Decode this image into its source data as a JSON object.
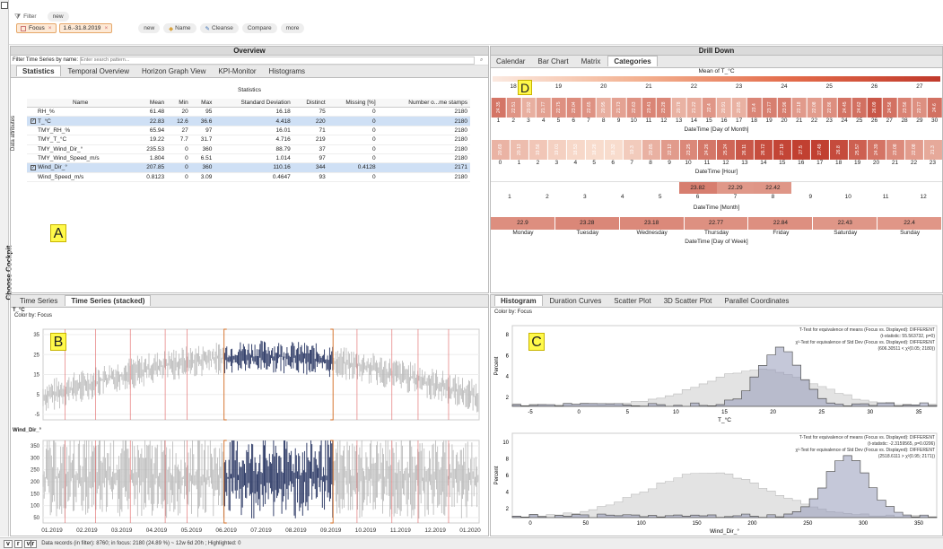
{
  "filter": {
    "label": "Filter",
    "new_pill": "new",
    "chip_focus": "Focus",
    "chip_dates": "1.6.-31.8.2019",
    "actions": [
      "new",
      "Name",
      "Cleanse",
      "Compare",
      "more"
    ]
  },
  "overview": {
    "title": "Overview",
    "search_label": "Filter Time Series by name:",
    "search_placeholder": "Enter search pattern...",
    "tabs": [
      "Statistics",
      "Temporal Overview",
      "Horizon Graph View",
      "KPI-Monitor",
      "Histograms"
    ],
    "table_title": "Statistics",
    "side_label": "Data attributes",
    "columns": [
      "Name",
      "Mean",
      "Min",
      "Max",
      "Standard Deviation",
      "Distinct",
      "Missing [%]",
      "Number o...me stamps"
    ],
    "rows": [
      {
        "name": "RH_%",
        "mean": "61.48",
        "min": "20",
        "max": "95",
        "sd": "16.18",
        "distinct": "75",
        "missing": "0",
        "n": "2180",
        "checked": false,
        "hl": false
      },
      {
        "name": "T_°C",
        "mean": "22.83",
        "min": "12.6",
        "max": "36.6",
        "sd": "4.418",
        "distinct": "220",
        "missing": "0",
        "n": "2180",
        "checked": true,
        "hl": true
      },
      {
        "name": "TMY_RH_%",
        "mean": "65.94",
        "min": "27",
        "max": "97",
        "sd": "16.01",
        "distinct": "71",
        "missing": "0",
        "n": "2180",
        "checked": false,
        "hl": false
      },
      {
        "name": "TMY_T_°C",
        "mean": "19.22",
        "min": "7.7",
        "max": "31.7",
        "sd": "4.716",
        "distinct": "219",
        "missing": "0",
        "n": "2180",
        "checked": false,
        "hl": false
      },
      {
        "name": "TMY_Wind_Dir_°",
        "mean": "235.53",
        "min": "0",
        "max": "360",
        "sd": "88.79",
        "distinct": "37",
        "missing": "0",
        "n": "2180",
        "checked": false,
        "hl": false
      },
      {
        "name": "TMY_Wind_Speed_m/s",
        "mean": "1.804",
        "min": "0",
        "max": "6.51",
        "sd": "1.014",
        "distinct": "97",
        "missing": "0",
        "n": "2180",
        "checked": false,
        "hl": false
      },
      {
        "name": "Wind_Dir_°",
        "mean": "207.85",
        "min": "0",
        "max": "360",
        "sd": "110.16",
        "distinct": "344",
        "missing": "0.4128",
        "n": "2171",
        "checked": true,
        "hl": true
      },
      {
        "name": "Wind_Speed_m/s",
        "mean": "0.8123",
        "min": "0",
        "max": "3.09",
        "sd": "0.4647",
        "distinct": "93",
        "missing": "0",
        "n": "2180",
        "checked": false,
        "hl": false
      }
    ]
  },
  "markers": {
    "a": "A",
    "b": "B",
    "c": "C",
    "d": "D"
  },
  "cockpit_label": "Choose Cockpit",
  "drill": {
    "title": "Drill Down",
    "tabs": [
      "Calendar",
      "Bar Chart",
      "Matrix",
      "Categories"
    ],
    "mean_label": "Mean of T_°C",
    "scale": [
      "18",
      "19",
      "20",
      "21",
      "22",
      "23",
      "24",
      "25",
      "26",
      "27"
    ],
    "day_values": [
      "24.35",
      "22.51",
      "20.92",
      "21.77",
      "22.75",
      "23.04",
      "22.65",
      "20.95",
      "21.73",
      "22.63",
      "23.41",
      "23.28",
      "20.78",
      "21.22",
      "22.4",
      "20.91",
      "20.85",
      "23.4",
      "23.77",
      "23.96",
      "22.18",
      "22.08",
      "22.86",
      "24.45",
      "24.62",
      "26.09",
      "24.56",
      "23.56",
      "22.77",
      "24.6"
    ],
    "day_labels": [
      "1",
      "2",
      "3",
      "4",
      "5",
      "6",
      "7",
      "8",
      "9",
      "10",
      "11",
      "12",
      "13",
      "14",
      "15",
      "16",
      "17",
      "18",
      "19",
      "20",
      "21",
      "22",
      "23",
      "24",
      "25",
      "26",
      "27",
      "28",
      "29",
      "30"
    ],
    "day_axis": "DateTime [Day of Month]",
    "hour_values": [
      "20.69",
      "20.13",
      "19.56",
      "19.01",
      "18.53",
      "18.28",
      "18.32",
      "19.3",
      "20.85",
      "22.12",
      "23.25",
      "24.26",
      "25.24",
      "26.11",
      "26.72",
      "27.19",
      "27.5",
      "27.49",
      "26.8",
      "25.57",
      "24.39",
      "23.08",
      "22.08",
      "21.3"
    ],
    "hour_labels": [
      "0",
      "1",
      "2",
      "3",
      "4",
      "5",
      "6",
      "7",
      "8",
      "9",
      "10",
      "11",
      "12",
      "13",
      "14",
      "15",
      "16",
      "17",
      "18",
      "19",
      "20",
      "21",
      "22",
      "23"
    ],
    "hour_axis": "DateTime [Hour]",
    "month_labels": [
      "1",
      "2",
      "3",
      "4",
      "5",
      "6",
      "7",
      "8",
      "9",
      "10",
      "11",
      "12"
    ],
    "month_values": {
      "6": "23.82",
      "7": "22.29",
      "8": "22.42"
    },
    "month_axis": "DateTime [Month]",
    "weekday_values": [
      "22.9",
      "23.28",
      "23.18",
      "22.77",
      "22.84",
      "22.43",
      "22.4"
    ],
    "weekday_labels": [
      "Monday",
      "Tuesday",
      "Wednesday",
      "Thursday",
      "Friday",
      "Saturday",
      "Sunday"
    ],
    "weekday_axis": "DateTime [Day of Week]"
  },
  "timeseries": {
    "tabs": [
      "Time Series",
      "Time Series (stacked)"
    ],
    "series1": "T_°C",
    "color_by": "Color by: Focus",
    "y1": [
      "35",
      "25",
      "15",
      "5",
      "-5"
    ],
    "series2": "Wind_Dir_°",
    "y2": [
      "350",
      "300",
      "250",
      "200",
      "150",
      "100",
      "50"
    ],
    "months": [
      "01.2019",
      "02.2019",
      "03.2019",
      "04.2019",
      "05.2019",
      "06.2019",
      "07.2019",
      "08.2019",
      "09.2019",
      "10.2019",
      "11.2019",
      "12.2019",
      "01.2020"
    ]
  },
  "histogram": {
    "tabs": [
      "Histogram",
      "Duration Curves",
      "Scatter Plot",
      "3D Scatter Plot",
      "Parallel Coordinates"
    ],
    "color_by": "Color by: Focus",
    "ylabel": "Percent",
    "h1_text": [
      "T-Test for equivalence of means (Focus vs. Displayed): DIFFERENT",
      "(t-statistic: 55.563732, p=0)",
      "χ²-Test for equivalence of Std Dev (Focus vs. Displayed): DIFFERENT",
      "(606.30511 < χ²(0.05; 2180))"
    ],
    "h1_y": [
      "8",
      "6",
      "4",
      "2"
    ],
    "h1_x": [
      "-5",
      "0",
      "5",
      "10",
      "15",
      "20",
      "25",
      "30",
      "35"
    ],
    "h1_xlabel": "T_°C",
    "h2_text": [
      "T-Test for equivalence of means (Focus vs. Displayed): DIFFERENT",
      "(t-statistic: -2.3159565, p=0.0206)",
      "χ²-Test for equivalence of Std Dev (Focus vs. Displayed): DIFFERENT",
      "(2518.6111 > χ²(0.95; 2171))"
    ],
    "h2_y": [
      "10",
      "8",
      "6",
      "4",
      "2"
    ],
    "h2_x": [
      "0",
      "50",
      "100",
      "150",
      "200",
      "250",
      "300",
      "350"
    ],
    "h2_xlabel": "Wind_Dir_°"
  },
  "status": {
    "text": "Data records (in filter): 8760; in focus: 2180 (24.89 %) ~ 12w 6d 20h ; Highlighted: 0",
    "btn1": "v",
    "btn2": "r",
    "btn3": "v|r"
  }
}
